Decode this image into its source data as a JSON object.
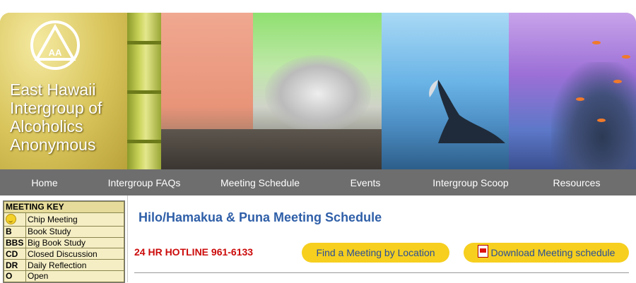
{
  "header": {
    "org_name_lines": [
      "East Hawaii",
      "Intergroup of",
      "Alcoholics",
      "Anonymous"
    ],
    "logo_text": "AA"
  },
  "nav": {
    "items": [
      {
        "label": "Home"
      },
      {
        "label": "Intergroup FAQs"
      },
      {
        "label": "Meeting Schedule"
      },
      {
        "label": "Events"
      },
      {
        "label": "Intergroup Scoop"
      },
      {
        "label": "Resources"
      }
    ]
  },
  "meeting_key": {
    "title": "MEETING KEY",
    "rows": [
      {
        "code": "",
        "icon": "smiley-icon",
        "label": "Chip Meeting"
      },
      {
        "code": "B",
        "label": "Book Study"
      },
      {
        "code": "BBS",
        "label": "Big Book Study"
      },
      {
        "code": "CD",
        "label": "Closed Discussion"
      },
      {
        "code": "DR",
        "label": "Daily Reflection"
      },
      {
        "code": "O",
        "label": "Open"
      }
    ]
  },
  "main": {
    "title": "Hilo/Hamakua & Puna Meeting Schedule",
    "hotline": "24 HR HOTLINE 961-6133",
    "find_button": "Find a Meeting by Location",
    "download_button": "Download Meeting schedule"
  },
  "colors": {
    "nav_bg": "#6e6e6e",
    "title": "#2f5fa8",
    "hotline": "#cc0a0a",
    "button_bg": "#f6cf1f",
    "key_bg": "#e6db9a"
  }
}
